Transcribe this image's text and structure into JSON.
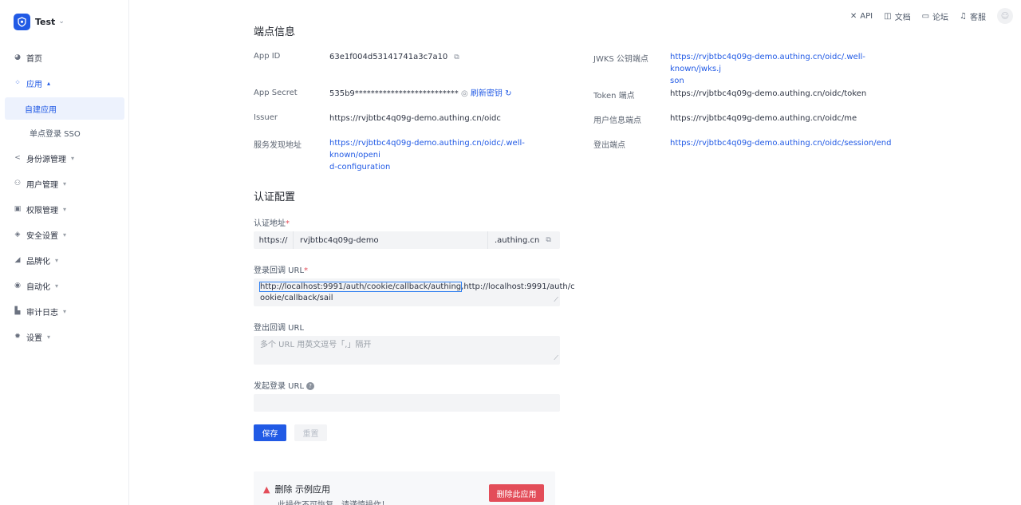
{
  "tenant": {
    "name": "Test"
  },
  "sidebar": {
    "items": [
      {
        "label": "首页",
        "icon": "dashboard-icon"
      },
      {
        "label": "应用",
        "icon": "apps-icon"
      },
      {
        "label": "自建应用"
      },
      {
        "label": "单点登录 SSO"
      },
      {
        "label": "身份源管理",
        "icon": "share-icon"
      },
      {
        "label": "用户管理",
        "icon": "users-icon"
      },
      {
        "label": "权限管理",
        "icon": "lock-icon"
      },
      {
        "label": "安全设置",
        "icon": "shield-icon"
      },
      {
        "label": "品牌化",
        "icon": "brush-icon"
      },
      {
        "label": "自动化",
        "icon": "automation-icon"
      },
      {
        "label": "审计日志",
        "icon": "chart-icon"
      },
      {
        "label": "设置",
        "icon": "gear-icon"
      }
    ]
  },
  "toolbar": {
    "api": "API",
    "docs": "文档",
    "forum": "论坛",
    "support": "客服"
  },
  "endpoints": {
    "title": "端点信息",
    "app_id_label": "App ID",
    "app_id": "63e1f004d53141741a3c7a10",
    "app_secret_label": "App Secret",
    "app_secret": "535b9**************************",
    "refresh_label": "刷新密钥",
    "issuer_label": "Issuer",
    "issuer": "https://rvjbtbc4q09g-demo.authing.cn/oidc",
    "discovery_label": "服务发现地址",
    "discovery_line1": "https://rvjbtbc4q09g-demo.authing.cn/oidc/.well-known/openi",
    "discovery_line2": "d-configuration",
    "jwks_label": "JWKS 公钥端点",
    "jwks_line1": "https://rvjbtbc4q09g-demo.authing.cn/oidc/.well-known/jwks.j",
    "jwks_line2": "son",
    "token_label": "Token 端点",
    "token": "https://rvjbtbc4q09g-demo.authing.cn/oidc/token",
    "userinfo_label": "用户信息端点",
    "userinfo": "https://rvjbtbc4q09g-demo.authing.cn/oidc/me",
    "logout_label": "登出端点",
    "logout": "https://rvjbtbc4q09g-demo.authing.cn/oidc/session/end"
  },
  "auth": {
    "title": "认证配置",
    "auth_url_label": "认证地址",
    "scheme": "https://",
    "subdomain": "rvjbtbc4q09g-demo",
    "suffix": ".authing.cn",
    "callback_label": "登录回调 URL",
    "callback_first": "http://localhost:9991/auth/cookie/callback/authing",
    "callback_rest": ",http://localhost:9991/auth/c",
    "callback_line2": "ookie/callback/sail",
    "logout_cb_label": "登出回调 URL",
    "logout_cb_placeholder": "多个 URL 用英文逗号「,」隔开",
    "initiate_label": "发起登录 URL",
    "save": "保存",
    "reset": "重置"
  },
  "danger": {
    "title": "删除 示例应用",
    "subtitle": "此操作不可恢复，请谨慎操作！",
    "button": "删除此应用"
  },
  "colors": {
    "primary": "#215ae5",
    "danger": "#e34d59",
    "highlight": "#2e7ff0"
  }
}
